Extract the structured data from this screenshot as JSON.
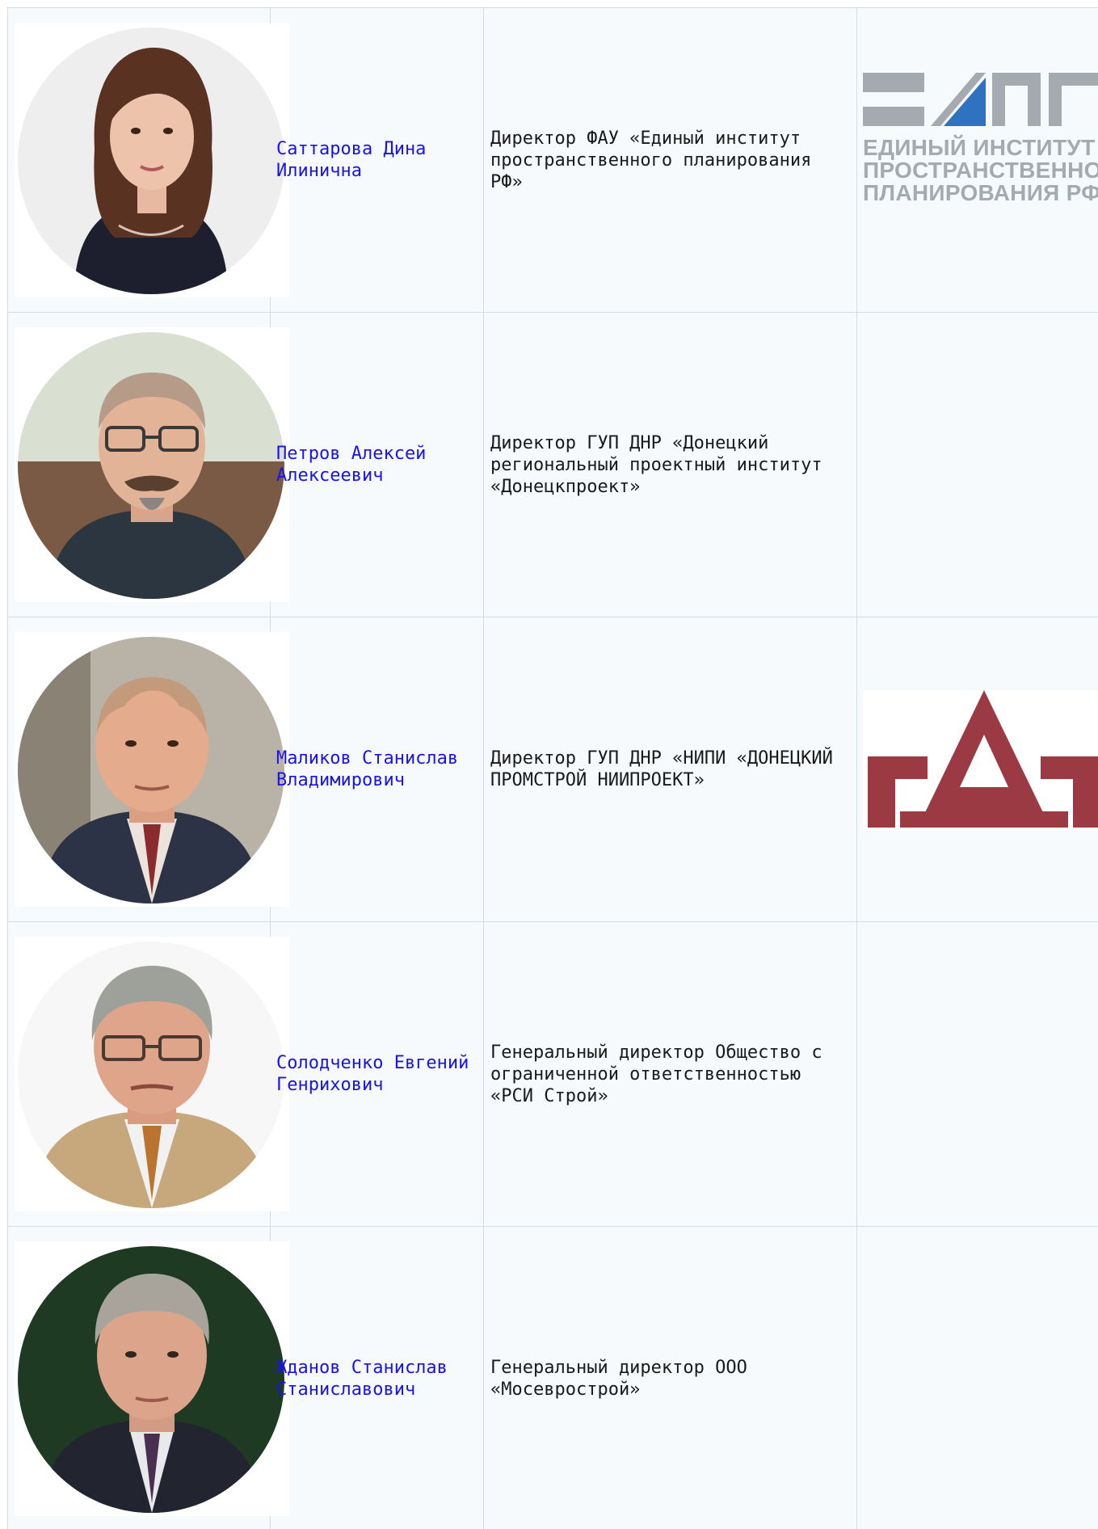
{
  "rows": [
    {
      "name": "Саттарова Дина Илинична",
      "role": "Директор ФАУ «Единый институт пространственного планирования РФ»",
      "photo": "female-portrait-photo",
      "logo": "eipp-logo"
    },
    {
      "name": "Петров Алексей Алексеевич",
      "role": "Директор ГУП ДНР «Донецкий региональный проектный институт «Донецкпроект»",
      "photo": "male-portrait-photo",
      "logo": ""
    },
    {
      "name": "Маликов Станислав Владимирович",
      "role": "Директор ГУП ДНР «НИПИ «ДОНЕЦКИЙ ПРОМСТРОЙ НИИПРОЕКТ»",
      "photo": "male-portrait-photo",
      "logo": "donetsk-promstroy-logo"
    },
    {
      "name": "Солодченко Евгений Генрихович",
      "role": "Генеральный директор Общество с ограниченной ответственностью «РСИ Строй»",
      "photo": "male-portrait-photo",
      "logo": ""
    },
    {
      "name": "Жданов Станислав Станиславович",
      "role": "Генеральный директор ООО «Мосеврострой»",
      "photo": "male-portrait-photo",
      "logo": ""
    }
  ],
  "logos": {
    "eipp": {
      "text_lines": [
        "ЕДИНЫЙ ИНСТИТУТ",
        "ПРОСТРАНСТВЕННОГО",
        "ПЛАНИРОВАНИЯ РФ"
      ],
      "gray": "#a5a9b0",
      "blue": "#2f73c0"
    },
    "gd": {
      "color": "#9c3a43"
    }
  },
  "colors": {
    "link": "#1a13e8",
    "text": "#1a1a1a",
    "cell_bg": "#f6fafc",
    "border": "#d3dce3"
  }
}
